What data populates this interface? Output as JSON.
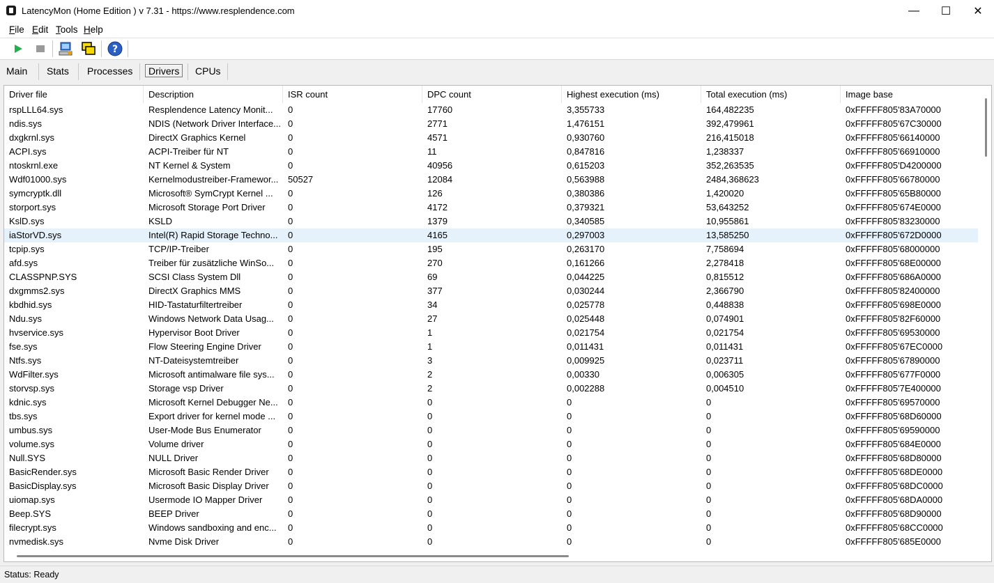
{
  "window": {
    "title": "LatencyMon  (Home Edition )  v 7.31 - https://www.resplendence.com",
    "minimize": "—",
    "maximize": "☐",
    "close": "✕"
  },
  "menu": [
    "File",
    "Edit",
    "Tools",
    "Help"
  ],
  "toolbar": {
    "icons": [
      "play-icon",
      "stop-icon",
      "computer-icon",
      "windows-icon",
      "help-icon"
    ],
    "help_glyph": "?"
  },
  "tabs": [
    "Main",
    "Stats",
    "Processes",
    "Drivers",
    "CPUs"
  ],
  "active_tab": "Drivers",
  "table": {
    "columns": [
      "Driver file",
      "Description",
      "ISR count",
      "DPC count",
      "Highest execution (ms)",
      "Total execution (ms)",
      "Image base"
    ],
    "selected_row": 9,
    "rows": [
      [
        "rspLLL64.sys",
        "Resplendence Latency Monit...",
        "0",
        "17760",
        "3,355733",
        "164,482235",
        "0xFFFFF805'83A70000"
      ],
      [
        "ndis.sys",
        "NDIS (Network Driver Interface...",
        "0",
        "2771",
        "1,476151",
        "392,479961",
        "0xFFFFF805'67C30000"
      ],
      [
        "dxgkrnl.sys",
        "DirectX Graphics Kernel",
        "0",
        "4571",
        "0,930760",
        "216,415018",
        "0xFFFFF805'66140000"
      ],
      [
        "ACPI.sys",
        "ACPI-Treiber für NT",
        "0",
        "11",
        "0,847816",
        "1,238337",
        "0xFFFFF805'66910000"
      ],
      [
        "ntoskrnl.exe",
        "NT Kernel & System",
        "0",
        "40956",
        "0,615203",
        "352,263535",
        "0xFFFFF805'D4200000"
      ],
      [
        "Wdf01000.sys",
        "Kernelmodustreiber-Framewor...",
        "50527",
        "12084",
        "0,563988",
        "2484,368623",
        "0xFFFFF805'66780000"
      ],
      [
        "symcryptk.dll",
        "Microsoft® SymCrypt Kernel ...",
        "0",
        "126",
        "0,380386",
        "1,420020",
        "0xFFFFF805'65B80000"
      ],
      [
        "storport.sys",
        "Microsoft Storage Port Driver",
        "0",
        "4172",
        "0,379321",
        "53,643252",
        "0xFFFFF805'674E0000"
      ],
      [
        "KslD.sys",
        "KSLD",
        "0",
        "1379",
        "0,340585",
        "10,955861",
        "0xFFFFF805'83230000"
      ],
      [
        "iaStorVD.sys",
        "Intel(R) Rapid Storage Techno...",
        "0",
        "4165",
        "0,297003",
        "13,585250",
        "0xFFFFF805'672D0000"
      ],
      [
        "tcpip.sys",
        "TCP/IP-Treiber",
        "0",
        "195",
        "0,263170",
        "7,758694",
        "0xFFFFF805'68000000"
      ],
      [
        "afd.sys",
        "Treiber für zusätzliche WinSo...",
        "0",
        "270",
        "0,161266",
        "2,278418",
        "0xFFFFF805'68E00000"
      ],
      [
        "CLASSPNP.SYS",
        "SCSI Class System Dll",
        "0",
        "69",
        "0,044225",
        "0,815512",
        "0xFFFFF805'686A0000"
      ],
      [
        "dxgmms2.sys",
        "DirectX Graphics MMS",
        "0",
        "377",
        "0,030244",
        "2,366790",
        "0xFFFFF805'82400000"
      ],
      [
        "kbdhid.sys",
        "HID-Tastaturfiltertreiber",
        "0",
        "34",
        "0,025778",
        "0,448838",
        "0xFFFFF805'698E0000"
      ],
      [
        "Ndu.sys",
        "Windows Network Data Usag...",
        "0",
        "27",
        "0,025448",
        "0,074901",
        "0xFFFFF805'82F60000"
      ],
      [
        "hvservice.sys",
        "Hypervisor Boot Driver",
        "0",
        "1",
        "0,021754",
        "0,021754",
        "0xFFFFF805'69530000"
      ],
      [
        "fse.sys",
        "Flow Steering Engine Driver",
        "0",
        "1",
        "0,011431",
        "0,011431",
        "0xFFFFF805'67EC0000"
      ],
      [
        "Ntfs.sys",
        "NT-Dateisystemtreiber",
        "0",
        "3",
        "0,009925",
        "0,023711",
        "0xFFFFF805'67890000"
      ],
      [
        "WdFilter.sys",
        "Microsoft antimalware file sys...",
        "0",
        "2",
        "0,00330",
        "0,006305",
        "0xFFFFF805'677F0000"
      ],
      [
        "storvsp.sys",
        "Storage vsp Driver",
        "0",
        "2",
        "0,002288",
        "0,004510",
        "0xFFFFF805'7E400000"
      ],
      [
        "kdnic.sys",
        "Microsoft Kernel Debugger Ne...",
        "0",
        "0",
        "0",
        "0",
        "0xFFFFF805'69570000"
      ],
      [
        "tbs.sys",
        "Export driver for kernel mode ...",
        "0",
        "0",
        "0",
        "0",
        "0xFFFFF805'68D60000"
      ],
      [
        "umbus.sys",
        "User-Mode Bus Enumerator",
        "0",
        "0",
        "0",
        "0",
        "0xFFFFF805'69590000"
      ],
      [
        "volume.sys",
        "Volume driver",
        "0",
        "0",
        "0",
        "0",
        "0xFFFFF805'684E0000"
      ],
      [
        "Null.SYS",
        "NULL Driver",
        "0",
        "0",
        "0",
        "0",
        "0xFFFFF805'68D80000"
      ],
      [
        "BasicRender.sys",
        "Microsoft Basic Render Driver",
        "0",
        "0",
        "0",
        "0",
        "0xFFFFF805'68DE0000"
      ],
      [
        "BasicDisplay.sys",
        "Microsoft Basic Display Driver",
        "0",
        "0",
        "0",
        "0",
        "0xFFFFF805'68DC0000"
      ],
      [
        "uiomap.sys",
        "Usermode IO Mapper Driver",
        "0",
        "0",
        "0",
        "0",
        "0xFFFFF805'68DA0000"
      ],
      [
        "Beep.SYS",
        "BEEP Driver",
        "0",
        "0",
        "0",
        "0",
        "0xFFFFF805'68D90000"
      ],
      [
        "filecrypt.sys",
        "Windows sandboxing and enc...",
        "0",
        "0",
        "0",
        "0",
        "0xFFFFF805'68CC0000"
      ],
      [
        "nvmedisk.sys",
        "Nvme Disk Driver",
        "0",
        "0",
        "0",
        "0",
        "0xFFFFF805'685E0000"
      ]
    ]
  },
  "status": "Status: Ready"
}
